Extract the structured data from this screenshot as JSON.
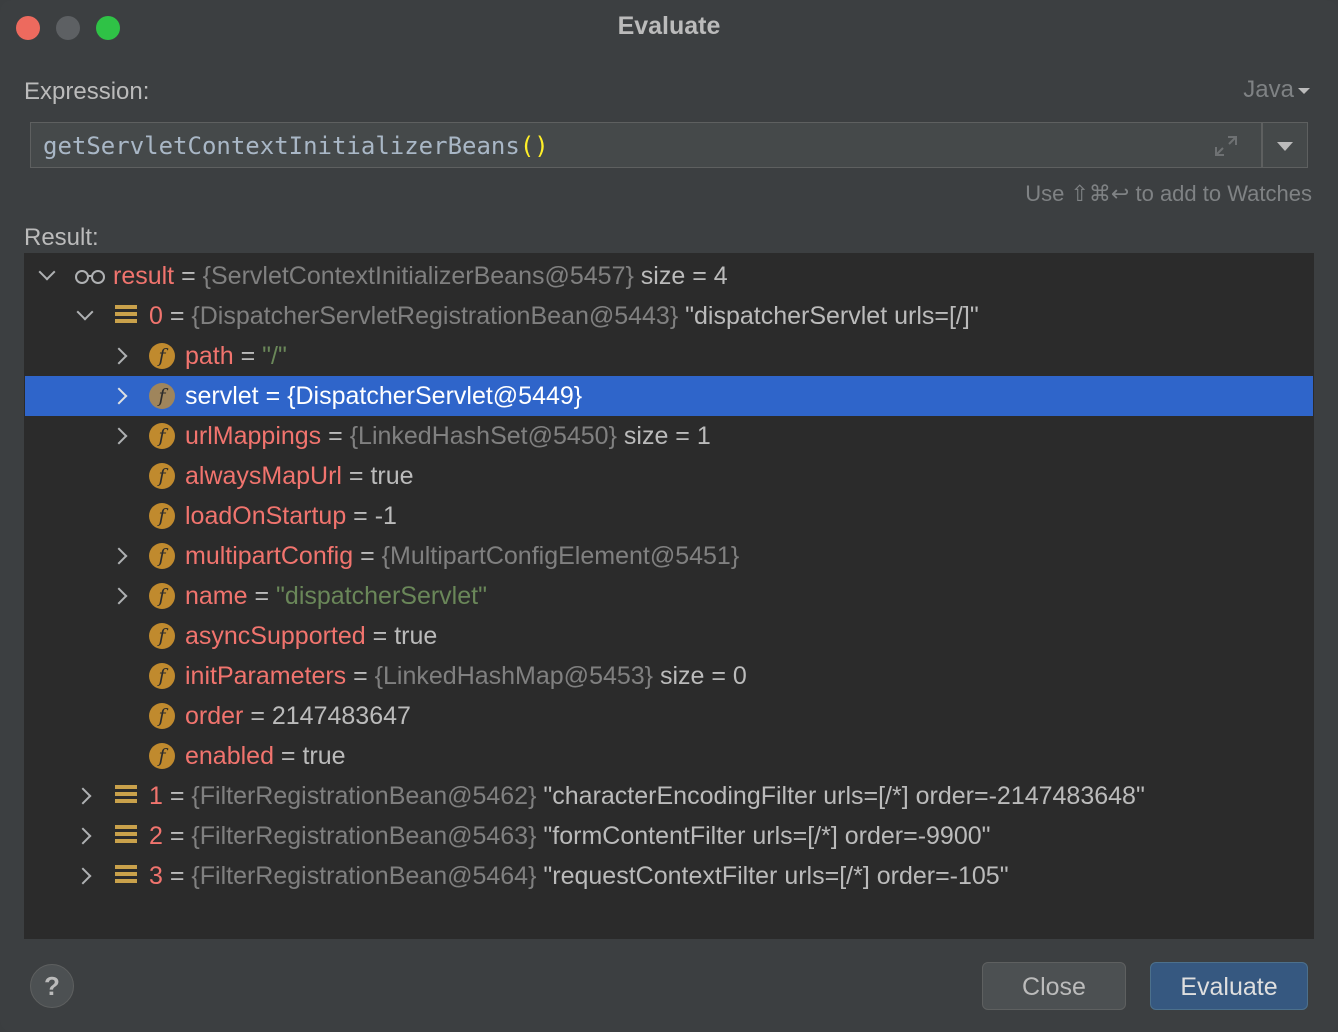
{
  "window": {
    "title": "Evaluate"
  },
  "expression": {
    "label": "Expression:",
    "language": "Java",
    "value": "getServletContextInitializerBeans",
    "parens": "()"
  },
  "hint": "Use ⇧⌘↩ to add to Watches",
  "result": {
    "label": "Result:",
    "rows": [
      {
        "name": "result",
        "eq": " = ",
        "type": "{ServletContextInitializerBeans@5457}",
        "value": "  size = 4"
      },
      {
        "name": "0",
        "eq": " = ",
        "type": "{DispatcherServletRegistrationBean@5443}",
        "value": " \"dispatcherServlet urls=[/]\""
      },
      {
        "name": "path",
        "eq": " = ",
        "value": "\"/\""
      },
      {
        "name": "servlet",
        "eq": " = ",
        "value": "{DispatcherServlet@5449}"
      },
      {
        "name": "urlMappings",
        "eq": " = ",
        "type": "{LinkedHashSet@5450}",
        "value": "  size = 1"
      },
      {
        "name": "alwaysMapUrl",
        "eq": " = ",
        "value": "true"
      },
      {
        "name": "loadOnStartup",
        "eq": " = ",
        "value": "-1"
      },
      {
        "name": "multipartConfig",
        "eq": " = ",
        "type": "{MultipartConfigElement@5451}"
      },
      {
        "name": "name",
        "eq": " = ",
        "value": "\"dispatcherServlet\""
      },
      {
        "name": "asyncSupported",
        "eq": " = ",
        "value": "true"
      },
      {
        "name": "initParameters",
        "eq": " = ",
        "type": "{LinkedHashMap@5453}",
        "value": "  size = 0"
      },
      {
        "name": "order",
        "eq": " = ",
        "value": "2147483647"
      },
      {
        "name": "enabled",
        "eq": " = ",
        "value": "true"
      },
      {
        "name": "1",
        "eq": " = ",
        "type": "{FilterRegistrationBean@5462}",
        "value": " \"characterEncodingFilter urls=[/*] order=-2147483648\""
      },
      {
        "name": "2",
        "eq": " = ",
        "type": "{FilterRegistrationBean@5463}",
        "value": " \"formContentFilter urls=[/*] order=-9900\""
      },
      {
        "name": "3",
        "eq": " = ",
        "type": "{FilterRegistrationBean@5464}",
        "value": " \"requestContextFilter urls=[/*] order=-105\""
      }
    ]
  },
  "buttons": {
    "help": "?",
    "close": "Close",
    "evaluate": "Evaluate"
  },
  "colors": {
    "selection": "#2f65ca",
    "field_name": "#f1746e",
    "string_value": "#6a8759",
    "type": "#808080"
  }
}
